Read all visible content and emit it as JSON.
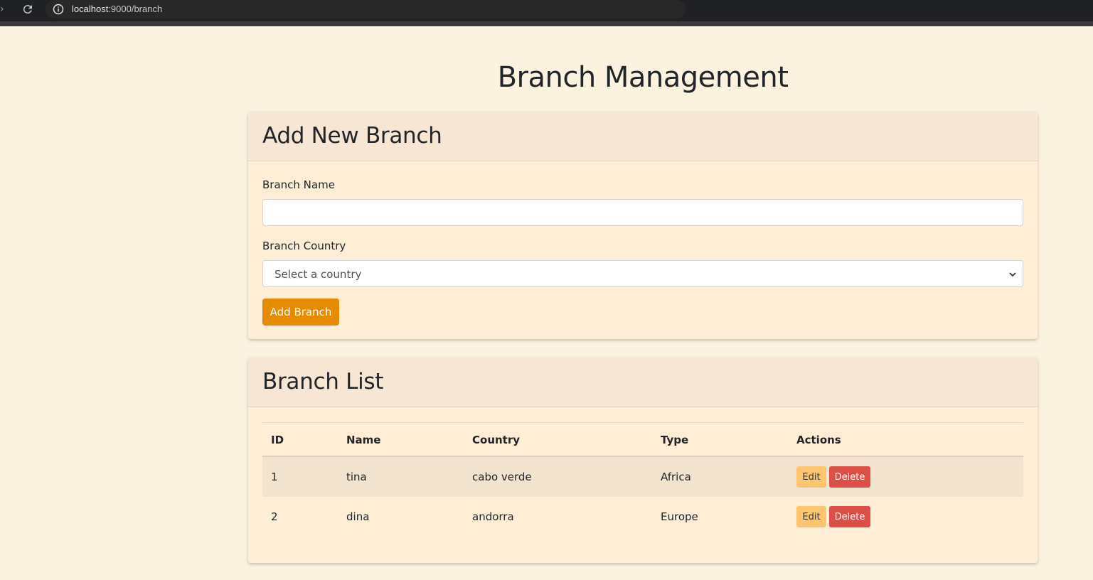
{
  "browser": {
    "url_host": "localhost",
    "url_rest": ":9000/branch"
  },
  "page": {
    "title": "Branch Management"
  },
  "add_card": {
    "title": "Add New Branch",
    "name_label": "Branch Name",
    "name_value": "",
    "country_label": "Branch Country",
    "country_selected": "Select a country",
    "submit_label": "Add Branch"
  },
  "list_card": {
    "title": "Branch List",
    "columns": [
      "ID",
      "Name",
      "Country",
      "Type",
      "Actions"
    ],
    "rows": [
      {
        "id": "1",
        "name": "tina",
        "country": "cabo verde",
        "type": "Africa"
      },
      {
        "id": "2",
        "name": "dina",
        "country": "andorra",
        "type": "Europe"
      }
    ],
    "edit_label": "Edit",
    "delete_label": "Delete"
  },
  "colors": {
    "page_bg": "#fbf3e0",
    "card_bg": "#ffedd6",
    "card_header_bg": "#f6e6d3",
    "primary_button": "#e68a00",
    "edit_button": "#ffc56e",
    "delete_button": "#dc4f45"
  },
  "icons": [
    "forward-icon",
    "reload-icon",
    "info-icon",
    "chevron-down-icon"
  ]
}
